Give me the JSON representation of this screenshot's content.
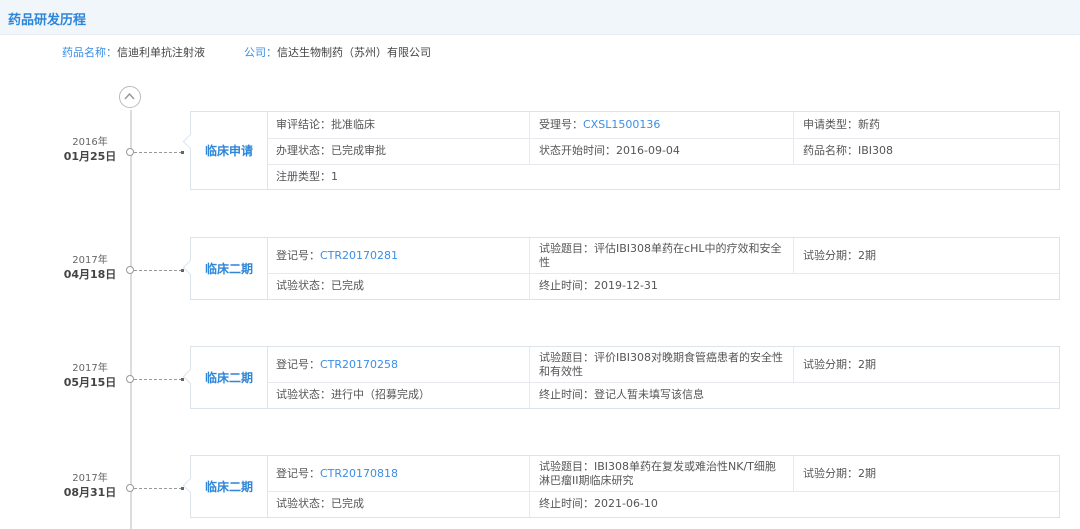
{
  "header": {
    "title": "药品研发历程"
  },
  "info": {
    "drug_label": "药品名称：",
    "drug_value": "信迪利单抗注射液",
    "company_label": "公司：",
    "company_value": "信达生物制药（苏州）有限公司"
  },
  "events": [
    {
      "year": "2016年",
      "day": "01月25日",
      "stage": "临床申请",
      "r1": {
        "a_label": "审评结论：",
        "a_value": "批准临床",
        "b_label": "受理号：",
        "b_value": "CXSL1500136",
        "c_label": "申请类型：",
        "c_value": "新药"
      },
      "r2": {
        "a_label": "办理状态：",
        "a_value": "已完成审批",
        "b_label": "状态开始时间：",
        "b_value": "2016-09-04",
        "c_label": "药品名称：",
        "c_value": "IBI308"
      },
      "r3": {
        "a_label": "注册类型：",
        "a_value": "1"
      }
    },
    {
      "year": "2017年",
      "day": "04月18日",
      "stage": "临床二期",
      "r1": {
        "a_label": "登记号：",
        "a_value": "CTR20170281",
        "b_label": "试验题目：",
        "b_value": "评估IBI308单药在cHL中的疗效和安全性",
        "c_label": "试验分期：",
        "c_value": "2期"
      },
      "r2": {
        "a_label": "试验状态：",
        "a_value": "已完成",
        "b_label": "终止时间：",
        "b_value": "2019-12-31"
      }
    },
    {
      "year": "2017年",
      "day": "05月15日",
      "stage": "临床二期",
      "r1": {
        "a_label": "登记号：",
        "a_value": "CTR20170258",
        "b_label": "试验题目：",
        "b_value": "评价IBI308对晚期食管癌患者的安全性和有效性",
        "c_label": "试验分期：",
        "c_value": "2期"
      },
      "r2": {
        "a_label": "试验状态：",
        "a_value": "进行中（招募完成）",
        "b_label": "终止时间：",
        "b_value": "登记人暂未填写该信息"
      }
    },
    {
      "year": "2017年",
      "day": "08月31日",
      "stage": "临床二期",
      "r1": {
        "a_label": "登记号：",
        "a_value": "CTR20170818",
        "b_label": "试验题目：",
        "b_value": "IBI308单药在复发或难治性NK/T细胞淋巴瘤II期临床研究",
        "c_label": "试验分期：",
        "c_value": "2期"
      },
      "r2": {
        "a_label": "试验状态：",
        "a_value": "已完成",
        "b_label": "终止时间：",
        "b_value": "2021-06-10"
      }
    }
  ]
}
